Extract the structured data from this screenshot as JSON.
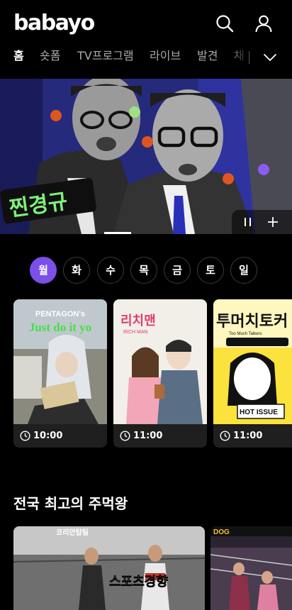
{
  "header": {
    "logo": "babayo",
    "search_icon": "search-icon",
    "profile_icon": "user-icon"
  },
  "nav": {
    "items": [
      {
        "label": "홈",
        "active": true
      },
      {
        "label": "숏폼",
        "active": false
      },
      {
        "label": "TV프로그램",
        "active": false
      },
      {
        "label": "라이브",
        "active": false
      },
      {
        "label": "발견",
        "active": false
      },
      {
        "label": "채",
        "active": false
      }
    ],
    "more_icon": "chevron-down-icon"
  },
  "banner": {
    "title_art": "찐경규",
    "active_slide": 1,
    "pause_icon": "pause-icon",
    "add_icon": "plus-icon"
  },
  "days": {
    "items": [
      "월",
      "화",
      "수",
      "목",
      "금",
      "토",
      "일"
    ],
    "selected": "월"
  },
  "schedule": [
    {
      "time": "10:00",
      "thumb_text_1": "PENTAGON's",
      "thumb_text_2": "Just do it yo"
    },
    {
      "time": "11:00",
      "thumb_text_1": "리치맨",
      "thumb_text_2": "RICH MAN"
    },
    {
      "time": "11:00",
      "thumb_text_1": "투머치토커",
      "thumb_text_2": "Too Much Talkers",
      "thumb_text_3": "HOT ISSUE"
    }
  ],
  "section": {
    "title": "전국 최고의 주먹왕"
  },
  "videos": [
    {
      "thumb_text": "스포츠경향",
      "thumb_small": "코리안탑팀"
    },
    {
      "thumb_text": "DOG"
    }
  ],
  "colors": {
    "accent": "#7b4fe8",
    "background": "#000000",
    "card": "#1f1f1f",
    "banner_bg": "#262a7c"
  }
}
